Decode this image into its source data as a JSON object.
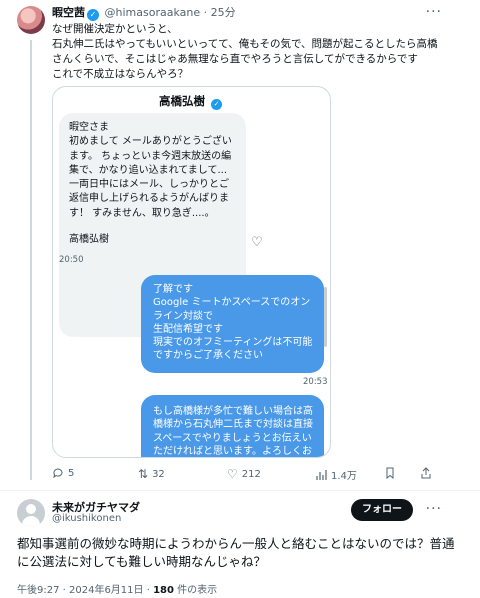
{
  "tweet1": {
    "display_name": "暇空茜",
    "handle": "@himasoraakane",
    "separator": "·",
    "time_ago": "25分",
    "more": "···",
    "lines": [
      "なぜ開催決定かというと、",
      "石丸伸二氏はやってもいいといってて、俺もその気で、問題が起こるとしたら高橋",
      "さんくらいで、そこはじゃあ無理なら直でやろうと言伝してができるからです",
      "これで不成立はならんやろ？"
    ],
    "dm": {
      "title": "高橋弘樹",
      "incoming": {
        "lines": [
          "暇空さま",
          "初めまして メールありがとうござい",
          "ます。 ちょっといま今週末放送の編",
          "集で、かなり追い込まれてまして...",
          "一両日中にはメール、しっかりとご",
          "返信申し上げられるようがんばりま",
          "す！ すみません、取り急ぎ....。"
        ],
        "signature": "高橋弘樹",
        "time": "20:50"
      },
      "outgoing1": {
        "lines": [
          "了解です",
          "Google ミートかスペースでのオン",
          "ライン対談で",
          "生配信希望です",
          "現実でのオフミーティングは不可能",
          "ですからご了承ください"
        ],
        "time": "20:53"
      },
      "outgoing2": {
        "lines": [
          "もし高橋様が多忙で難しい場合は高",
          "橋様から石丸伸二氏まで対談は直接",
          "スペースでやりましょうとお伝えい",
          "ただければと思います。よろしくお"
        ]
      }
    },
    "actions": {
      "replies": "5",
      "retweets": "32",
      "likes": "212",
      "views": "1.4万"
    }
  },
  "tweet2": {
    "display_name": "未来がガチヤマダ",
    "handle": "@ikushikonen",
    "follow_label": "フォロー",
    "more": "···",
    "lines": [
      "都知事選前の微妙な時期にようわからん一般人と絡むことはないのでは？普通",
      "に公選法に対しても難しい時期なんじゃね？"
    ],
    "timestamp": "午後9:27 · 2024年6月11日 · ",
    "views_count": "180",
    "views_suffix": " 件の表示"
  },
  "colors": {
    "accent_blue": "#1d9bf0",
    "dm_outgoing": "#4a99e9",
    "dm_incoming": "#eff3f4",
    "muted_text": "#536471"
  }
}
